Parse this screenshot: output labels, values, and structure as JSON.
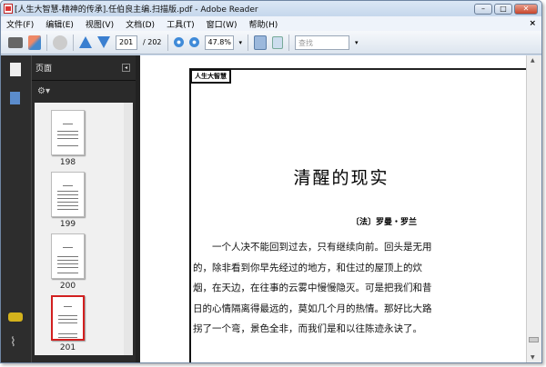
{
  "window": {
    "title": "[人生大智慧-精神的传承].任伯良主编.扫描版.pdf - Adobe Reader",
    "minimize": "–",
    "maximize": "□",
    "close": "✕"
  },
  "menu": [
    "文件(F)",
    "编辑(E)",
    "视图(V)",
    "文档(D)",
    "工具(T)",
    "窗口(W)",
    "帮助(H)"
  ],
  "menu_close": "×",
  "toolbar": {
    "page_current": "201",
    "page_total": "/ 202",
    "zoom": "47.8%",
    "search_placeholder": "查找"
  },
  "panel": {
    "title": "页面",
    "collapse": "◂",
    "gear": "⚙▾",
    "thumbnails": [
      {
        "label": "198"
      },
      {
        "label": "199"
      },
      {
        "label": "200"
      },
      {
        "label": "201",
        "selected": true
      }
    ]
  },
  "document": {
    "header": "人生大智慧",
    "title": "清醒的现实",
    "author": "〔法〕罗曼・罗兰",
    "paragraph": [
      "一个人决不能回到过去，只有继续向前。回头是无用",
      "的，除非看到你早先经过的地方，和住过的屋顶上的炊",
      "烟，在天边，在往事的云雾中慢慢隐灭。可是把我们和昔",
      "日的心情隔离得最远的，莫如几个月的热情。那好比大路",
      "拐了一个弯，景色全非，而我们是和以往陈迹永诀了。"
    ]
  },
  "colors": {
    "accent": "#3a7fd0",
    "selection": "#d22020"
  }
}
